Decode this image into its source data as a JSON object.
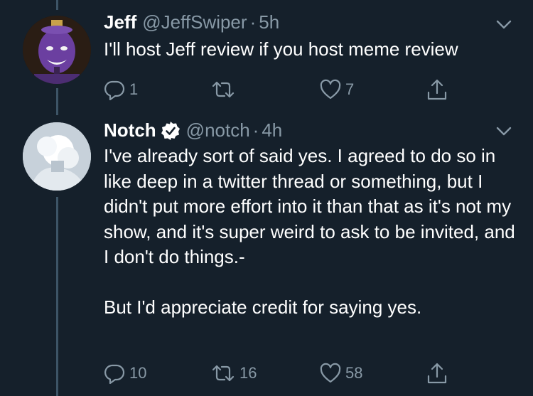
{
  "tweets": [
    {
      "name": "Jeff",
      "handle": "@JeffSwiper",
      "separator": "·",
      "time": "5h",
      "verified": false,
      "text": "I'll host Jeff review if you host meme review",
      "replies": "1",
      "retweets": "",
      "likes": "7",
      "avatar_color": "#6b3fa0"
    },
    {
      "name": "Notch",
      "handle": "@notch",
      "separator": "·",
      "time": "4h",
      "verified": true,
      "text": "I've already sort of said yes. I agreed to do so in like deep in a twitter thread or something, but I didn't put more effort into it than that as it's not my show, and it's super weird to ask to be invited, and I don't do things.-\n\nBut I'd appreciate credit for saying yes.",
      "replies": "10",
      "retweets": "16",
      "likes": "58",
      "avatar_color": "#dde4ea"
    }
  ],
  "colors": {
    "background": "#15202b",
    "secondary_text": "#8899a6",
    "thread_line": "#3d5466",
    "verified": "#ffffff"
  },
  "icons": {
    "reply": "reply-icon",
    "retweet": "retweet-icon",
    "like": "heart-icon",
    "share": "share-icon",
    "menu": "chevron-down-icon",
    "verified": "verified-badge-icon"
  }
}
